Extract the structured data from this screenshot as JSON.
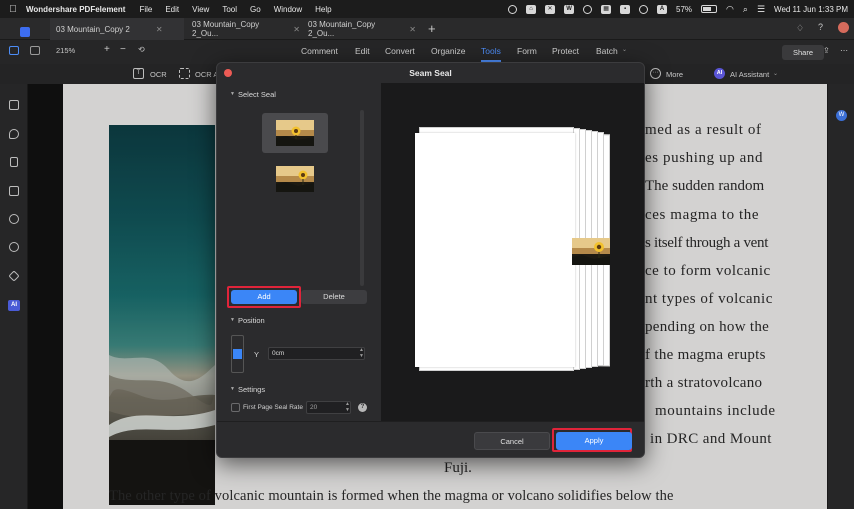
{
  "menubar": {
    "app_name": "Wondershare PDFelement",
    "items": [
      "File",
      "Edit",
      "View",
      "Tool",
      "Go",
      "Window",
      "Help"
    ],
    "battery": "57%",
    "datetime": "Wed 11 Jun  1:33 PM"
  },
  "tabs": [
    {
      "label": "03 Mountain_Copy 2",
      "active": true
    },
    {
      "label": "03 Mountain_Copy 2_Ou..."
    },
    {
      "label": "03 Mountain_Copy 2_Ou..."
    }
  ],
  "toolbar": {
    "zoom": "215%",
    "nav": [
      "Comment",
      "Edit",
      "Convert",
      "Organize",
      "Tools",
      "Form",
      "Protect",
      "Batch"
    ],
    "active_nav": "Tools",
    "share_label": "Share"
  },
  "subtoolbar": {
    "ocr_label": "OCR",
    "ocr_area_label": "OCR A",
    "more_label": "More",
    "ai_label": "AI Assistant"
  },
  "sidebar": {
    "ai_label": "AI"
  },
  "document": {
    "lines": [
      "med as a result of",
      "es pushing up and",
      "The sudden random",
      "ces magma to the",
      "s itself through a vent",
      "ce to form volcanic",
      "nt types of volcanic",
      "pending on how the",
      "f the magma erupts",
      "rth a stratovolcano",
      "mountains include",
      "in DRC and Mount",
      "Fuji.",
      "The other type of volcanic mountain is formed when the magma or volcano solidifies below the"
    ]
  },
  "modal": {
    "title": "Seam Seal",
    "select_seal_label": "Select Seal",
    "add_label": "Add",
    "delete_label": "Delete",
    "position_label": "Position",
    "y_label": "Y",
    "y_value": "0cm",
    "settings_label": "Settings",
    "first_page_label": "First Page Seal Rate",
    "rate_value": "20",
    "cancel_label": "Cancel",
    "apply_label": "Apply"
  },
  "colors": {
    "accent": "#3b86f7",
    "highlight": "#e0243a",
    "close_dot": "#ed5b55"
  }
}
